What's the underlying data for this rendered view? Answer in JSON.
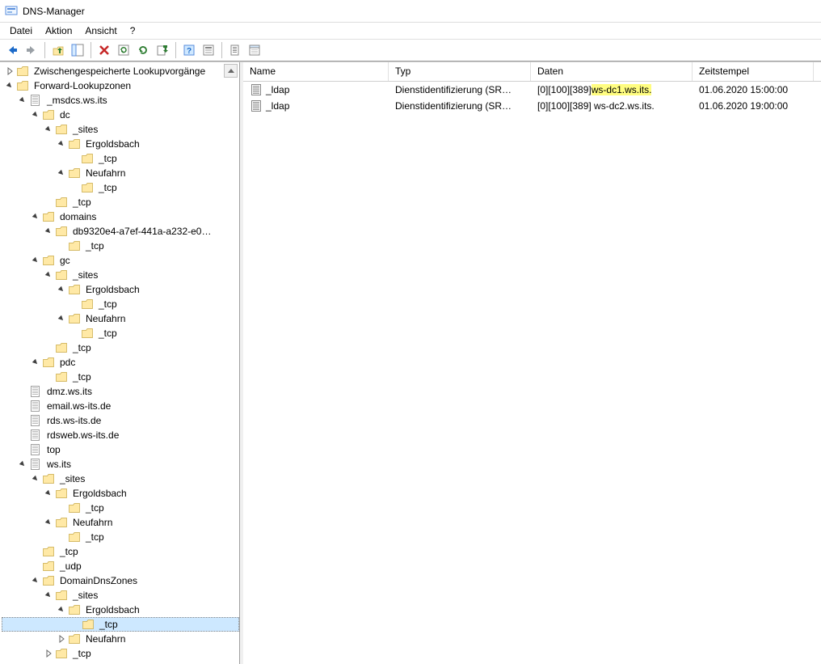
{
  "app": {
    "title": "DNS-Manager"
  },
  "menu": {
    "datei": "Datei",
    "aktion": "Aktion",
    "ansicht": "Ansicht",
    "help": "?"
  },
  "toolbar": {
    "back": "back",
    "forward": "forward",
    "up": "up",
    "showhide": "show-tree",
    "delete": "delete",
    "refresh": "refresh",
    "refresh2": "requery",
    "export": "export",
    "help": "help",
    "properties": "properties",
    "newrec": "new-record",
    "newzone": "new-zone"
  },
  "tree": {
    "cached": "Zwischengespeicherte Lookupvorgänge",
    "fwd": "Forward-Lookupzonen",
    "msdcs": "_msdcs.ws.its",
    "dc": "dc",
    "sites": "_sites",
    "ergoldsbach": "Ergoldsbach",
    "tcp": "_tcp",
    "neufahrn": "Neufahrn",
    "domains": "domains",
    "guid": "db9320e4-a7ef-441a-a232-e0…",
    "gc": "gc",
    "pdc": "pdc",
    "dmz": "dmz.ws.its",
    "email": "email.ws-its.de",
    "rds": "rds.ws-its.de",
    "rdsweb": "rdsweb.ws-its.de",
    "top": "top",
    "wsits": "ws.its",
    "udp": "_udp",
    "ddz": "DomainDnsZones"
  },
  "columns": {
    "name": "Name",
    "type": "Typ",
    "data": "Daten",
    "ts": "Zeitstempel"
  },
  "records": [
    {
      "name": "_ldap",
      "type": "Dienstidentifizierung (SR…",
      "data_prefix": "[0][100][389] ",
      "data_host": "ws-dc1.ws.its.",
      "ts": "01.06.2020 15:00:00",
      "hl": true
    },
    {
      "name": "_ldap",
      "type": "Dienstidentifizierung (SR…",
      "data_prefix": "[0][100][389] ",
      "data_host": "ws-dc2.ws.its.",
      "ts": "01.06.2020 19:00:00",
      "hl": false
    }
  ]
}
